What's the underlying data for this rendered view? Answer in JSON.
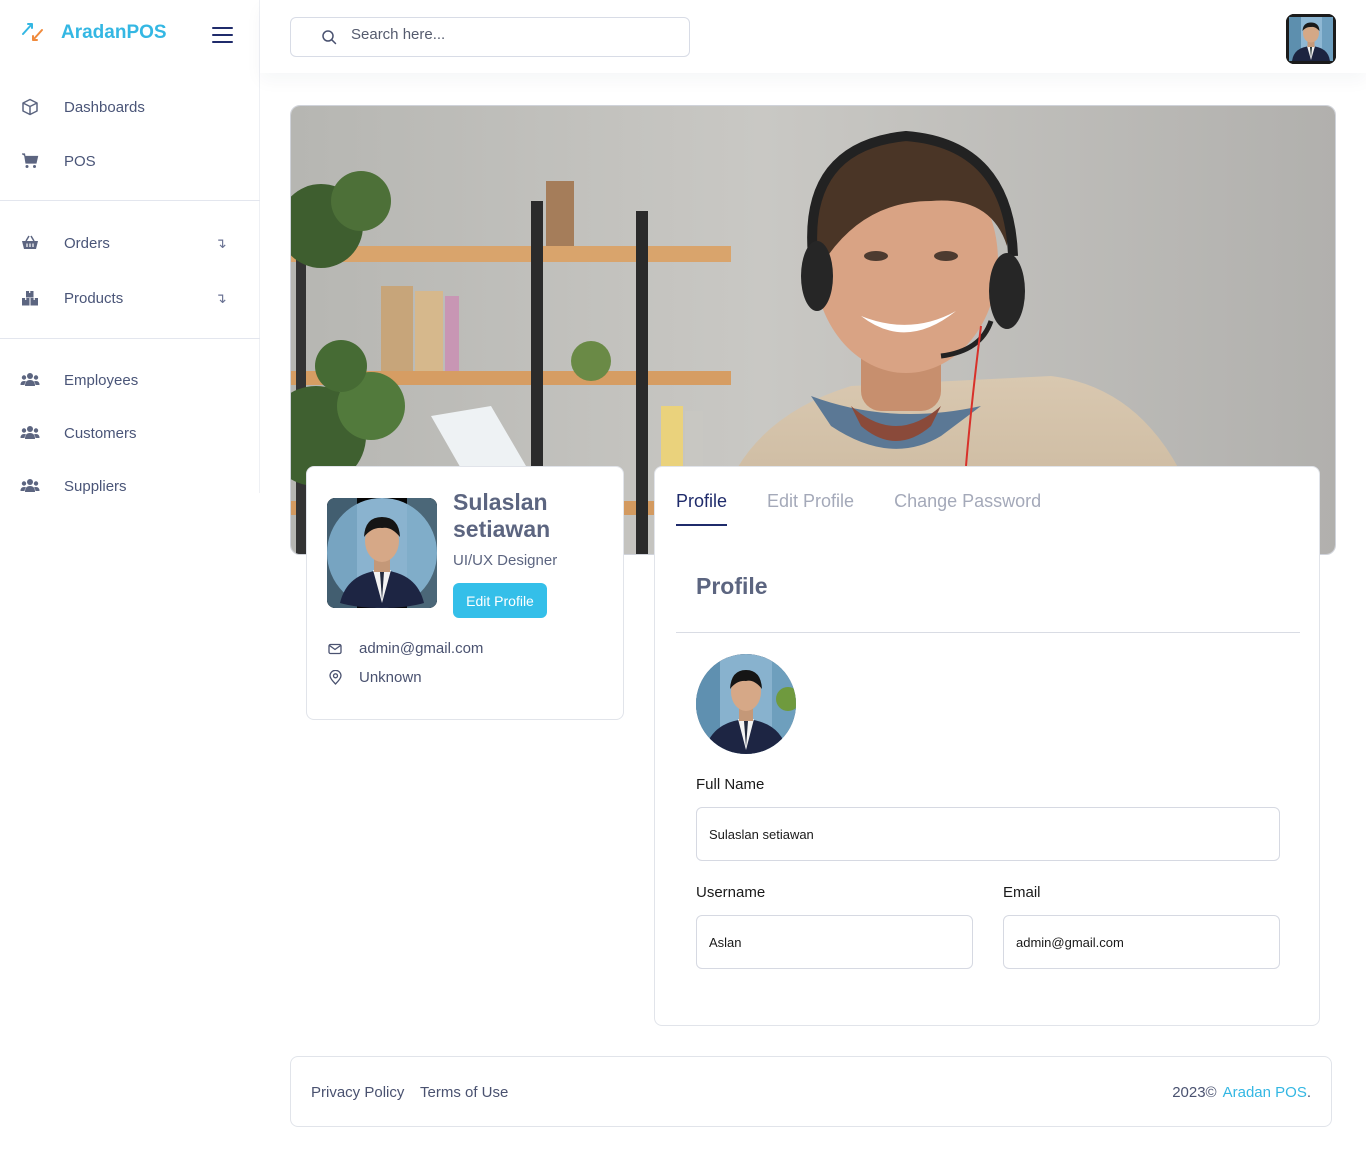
{
  "brand": {
    "name": "AradanPOS"
  },
  "sidebar": {
    "items": [
      {
        "label": "Dashboards",
        "icon": "cube-icon"
      },
      {
        "label": "POS",
        "icon": "cart-icon"
      },
      {
        "label": "Orders",
        "icon": "basket-icon",
        "chevron": "↴"
      },
      {
        "label": "Products",
        "icon": "boxes-icon",
        "chevron": "↴"
      },
      {
        "label": "Employees",
        "icon": "users-icon"
      },
      {
        "label": "Customers",
        "icon": "users-icon"
      },
      {
        "label": "Suppliers",
        "icon": "users-icon"
      }
    ]
  },
  "search": {
    "placeholder": "Search here..."
  },
  "profile_card": {
    "name": "Sulaslan setiawan",
    "role": "UI/UX Designer",
    "edit_button": "Edit Profile",
    "email": "admin@gmail.com",
    "location": "Unknown"
  },
  "tabs": [
    "Profile",
    "Edit Profile",
    "Change Password"
  ],
  "profile_section": {
    "title": "Profile",
    "fullname_label": "Full Name",
    "fullname_value": "Sulaslan setiawan",
    "username_label": "Username",
    "username_value": "Aslan",
    "email_label": "Email",
    "email_value": "admin@gmail.com"
  },
  "footer": {
    "privacy": "Privacy Policy",
    "terms": "Terms of Use",
    "copyright": "2023©",
    "brand_link": "Aradan POS",
    "suffix": "."
  },
  "colors": {
    "accent": "#34b7e3",
    "navy": "#1f2b6b",
    "button": "#34bfe9"
  }
}
